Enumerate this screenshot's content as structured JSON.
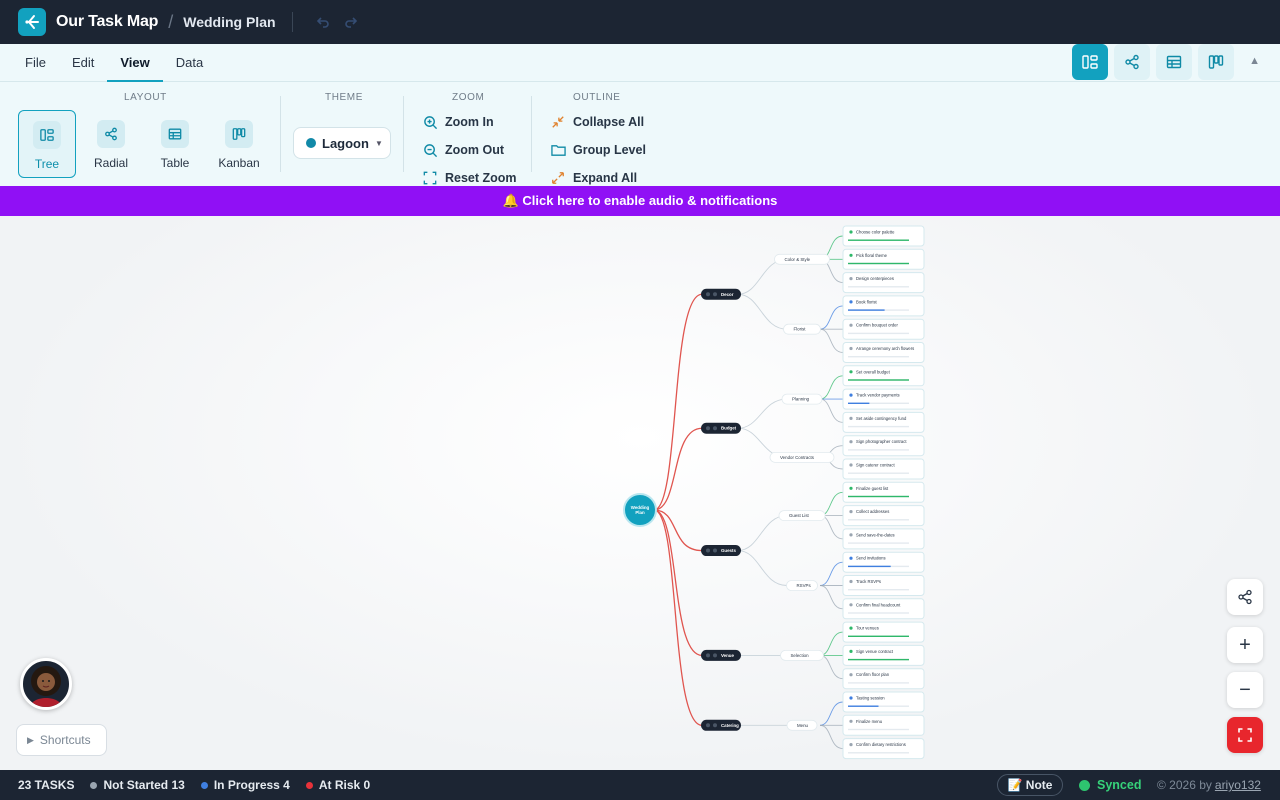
{
  "header": {
    "app_title": "Our Task Map",
    "breadcrumb_sep": "/",
    "project_name": "Wedding Plan"
  },
  "menu": {
    "tabs": [
      {
        "label": "File"
      },
      {
        "label": "Edit"
      },
      {
        "label": "View",
        "active": true
      },
      {
        "label": "Data"
      }
    ]
  },
  "ribbon": {
    "layout_label": "LAYOUT",
    "layouts": [
      {
        "label": "Tree",
        "active": true
      },
      {
        "label": "Radial"
      },
      {
        "label": "Table"
      },
      {
        "label": "Kanban"
      }
    ],
    "theme_label": "THEME",
    "theme_value": "Lagoon",
    "zoom_label": "ZOOM",
    "zoom_in": "Zoom In",
    "zoom_out": "Zoom Out",
    "reset_zoom": "Reset Zoom",
    "outline_label": "OUTLINE",
    "collapse_all": "Collapse All",
    "group_level": "Group Level",
    "expand_all": "Expand All"
  },
  "notice": "🔔 Click here to enable audio & notifications",
  "mindmap": {
    "root": "Wedding Plan",
    "branches": [
      {
        "name": "Decor",
        "groups": [
          {
            "name": "Color & Style",
            "tasks": [
              {
                "name": "Choose color palette",
                "status": "done",
                "progress": 1.0
              },
              {
                "name": "Pick floral theme",
                "status": "done",
                "progress": 1.0
              },
              {
                "name": "Design centerpieces",
                "status": "not-started",
                "progress": 0.0
              }
            ]
          },
          {
            "name": "Florist",
            "tasks": [
              {
                "name": "Book florist",
                "status": "in-progress",
                "progress": 0.6
              },
              {
                "name": "Confirm bouquet order",
                "status": "not-started",
                "progress": 0.0
              },
              {
                "name": "Arrange ceremony arch flowers",
                "status": "not-started",
                "progress": 0.0
              }
            ]
          }
        ]
      },
      {
        "name": "Budget",
        "groups": [
          {
            "name": "Planning",
            "tasks": [
              {
                "name": "Set overall budget",
                "status": "done",
                "progress": 1.0
              },
              {
                "name": "Track vendor payments",
                "status": "in-progress",
                "progress": 0.35
              },
              {
                "name": "Set aside contingency fund",
                "status": "not-started",
                "progress": 0.0
              }
            ]
          },
          {
            "name": "Vendor Contracts",
            "tasks": [
              {
                "name": "Sign photographer contract",
                "status": "not-started",
                "progress": 0.0
              },
              {
                "name": "Sign caterer contract",
                "status": "not-started",
                "progress": 0.0
              }
            ]
          }
        ]
      },
      {
        "name": "Guests",
        "groups": [
          {
            "name": "Guest List",
            "tasks": [
              {
                "name": "Finalize guest list",
                "status": "done",
                "progress": 1.0
              },
              {
                "name": "Collect addresses",
                "status": "not-started",
                "progress": 0.0
              },
              {
                "name": "Send save-the-dates",
                "status": "not-started",
                "progress": 0.0
              }
            ]
          },
          {
            "name": "RSVPs",
            "tasks": [
              {
                "name": "Send invitations",
                "status": "in-progress",
                "progress": 0.7
              },
              {
                "name": "Track RSVPs",
                "status": "not-started",
                "progress": 0.0
              },
              {
                "name": "Confirm final headcount",
                "status": "not-started",
                "progress": 0.0
              }
            ]
          }
        ]
      },
      {
        "name": "Venue",
        "groups": [
          {
            "name": "Selection",
            "tasks": [
              {
                "name": "Tour venues",
                "status": "done",
                "progress": 1.0
              },
              {
                "name": "Sign venue contract",
                "status": "done",
                "progress": 1.0
              },
              {
                "name": "Confirm floor plan",
                "status": "not-started",
                "progress": 0.0
              }
            ]
          }
        ]
      },
      {
        "name": "Catering",
        "groups": [
          {
            "name": "Menu",
            "tasks": [
              {
                "name": "Tasting session",
                "status": "in-progress",
                "progress": 0.5
              },
              {
                "name": "Finalize menu",
                "status": "not-started",
                "progress": 0.0
              },
              {
                "name": "Confirm dietary restrictions",
                "status": "not-started",
                "progress": 0.0
              }
            ]
          }
        ]
      }
    ]
  },
  "shortcuts": "Shortcuts",
  "status": {
    "total": "23 TASKS",
    "not_started": "Not Started 13",
    "in_progress": "In Progress 4",
    "at_risk": "At Risk 0",
    "note": "📝 Note",
    "synced": "Synced",
    "copyright": "© 2026 by",
    "author": "ariyo132"
  },
  "colors": {
    "accent": "#12a1bf",
    "topbar": "#1c2533",
    "notice": "#9010f5",
    "done": "#2fb86a",
    "in_progress": "#3f7fe0",
    "not_started": "#9aa5b1",
    "at_risk": "#e8323a",
    "branch_link": "#e0554f"
  }
}
